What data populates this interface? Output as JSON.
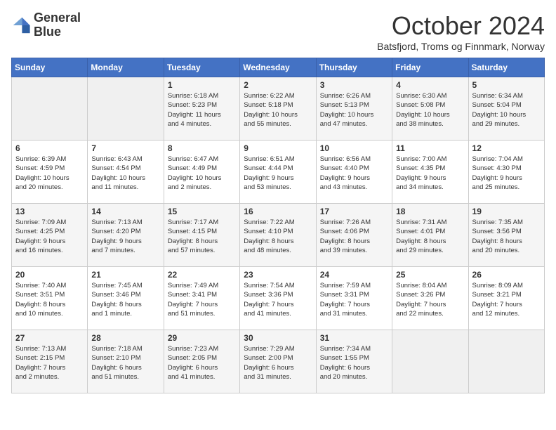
{
  "header": {
    "logo_line1": "General",
    "logo_line2": "Blue",
    "month": "October 2024",
    "location": "Batsfjord, Troms og Finnmark, Norway"
  },
  "weekdays": [
    "Sunday",
    "Monday",
    "Tuesday",
    "Wednesday",
    "Thursday",
    "Friday",
    "Saturday"
  ],
  "weeks": [
    [
      {
        "day": "",
        "info": ""
      },
      {
        "day": "",
        "info": ""
      },
      {
        "day": "1",
        "info": "Sunrise: 6:18 AM\nSunset: 5:23 PM\nDaylight: 11 hours\nand 4 minutes."
      },
      {
        "day": "2",
        "info": "Sunrise: 6:22 AM\nSunset: 5:18 PM\nDaylight: 10 hours\nand 55 minutes."
      },
      {
        "day": "3",
        "info": "Sunrise: 6:26 AM\nSunset: 5:13 PM\nDaylight: 10 hours\nand 47 minutes."
      },
      {
        "day": "4",
        "info": "Sunrise: 6:30 AM\nSunset: 5:08 PM\nDaylight: 10 hours\nand 38 minutes."
      },
      {
        "day": "5",
        "info": "Sunrise: 6:34 AM\nSunset: 5:04 PM\nDaylight: 10 hours\nand 29 minutes."
      }
    ],
    [
      {
        "day": "6",
        "info": "Sunrise: 6:39 AM\nSunset: 4:59 PM\nDaylight: 10 hours\nand 20 minutes."
      },
      {
        "day": "7",
        "info": "Sunrise: 6:43 AM\nSunset: 4:54 PM\nDaylight: 10 hours\nand 11 minutes."
      },
      {
        "day": "8",
        "info": "Sunrise: 6:47 AM\nSunset: 4:49 PM\nDaylight: 10 hours\nand 2 minutes."
      },
      {
        "day": "9",
        "info": "Sunrise: 6:51 AM\nSunset: 4:44 PM\nDaylight: 9 hours\nand 53 minutes."
      },
      {
        "day": "10",
        "info": "Sunrise: 6:56 AM\nSunset: 4:40 PM\nDaylight: 9 hours\nand 43 minutes."
      },
      {
        "day": "11",
        "info": "Sunrise: 7:00 AM\nSunset: 4:35 PM\nDaylight: 9 hours\nand 34 minutes."
      },
      {
        "day": "12",
        "info": "Sunrise: 7:04 AM\nSunset: 4:30 PM\nDaylight: 9 hours\nand 25 minutes."
      }
    ],
    [
      {
        "day": "13",
        "info": "Sunrise: 7:09 AM\nSunset: 4:25 PM\nDaylight: 9 hours\nand 16 minutes."
      },
      {
        "day": "14",
        "info": "Sunrise: 7:13 AM\nSunset: 4:20 PM\nDaylight: 9 hours\nand 7 minutes."
      },
      {
        "day": "15",
        "info": "Sunrise: 7:17 AM\nSunset: 4:15 PM\nDaylight: 8 hours\nand 57 minutes."
      },
      {
        "day": "16",
        "info": "Sunrise: 7:22 AM\nSunset: 4:10 PM\nDaylight: 8 hours\nand 48 minutes."
      },
      {
        "day": "17",
        "info": "Sunrise: 7:26 AM\nSunset: 4:06 PM\nDaylight: 8 hours\nand 39 minutes."
      },
      {
        "day": "18",
        "info": "Sunrise: 7:31 AM\nSunset: 4:01 PM\nDaylight: 8 hours\nand 29 minutes."
      },
      {
        "day": "19",
        "info": "Sunrise: 7:35 AM\nSunset: 3:56 PM\nDaylight: 8 hours\nand 20 minutes."
      }
    ],
    [
      {
        "day": "20",
        "info": "Sunrise: 7:40 AM\nSunset: 3:51 PM\nDaylight: 8 hours\nand 10 minutes."
      },
      {
        "day": "21",
        "info": "Sunrise: 7:45 AM\nSunset: 3:46 PM\nDaylight: 8 hours\nand 1 minute."
      },
      {
        "day": "22",
        "info": "Sunrise: 7:49 AM\nSunset: 3:41 PM\nDaylight: 7 hours\nand 51 minutes."
      },
      {
        "day": "23",
        "info": "Sunrise: 7:54 AM\nSunset: 3:36 PM\nDaylight: 7 hours\nand 41 minutes."
      },
      {
        "day": "24",
        "info": "Sunrise: 7:59 AM\nSunset: 3:31 PM\nDaylight: 7 hours\nand 31 minutes."
      },
      {
        "day": "25",
        "info": "Sunrise: 8:04 AM\nSunset: 3:26 PM\nDaylight: 7 hours\nand 22 minutes."
      },
      {
        "day": "26",
        "info": "Sunrise: 8:09 AM\nSunset: 3:21 PM\nDaylight: 7 hours\nand 12 minutes."
      }
    ],
    [
      {
        "day": "27",
        "info": "Sunrise: 7:13 AM\nSunset: 2:15 PM\nDaylight: 7 hours\nand 2 minutes."
      },
      {
        "day": "28",
        "info": "Sunrise: 7:18 AM\nSunset: 2:10 PM\nDaylight: 6 hours\nand 51 minutes."
      },
      {
        "day": "29",
        "info": "Sunrise: 7:23 AM\nSunset: 2:05 PM\nDaylight: 6 hours\nand 41 minutes."
      },
      {
        "day": "30",
        "info": "Sunrise: 7:29 AM\nSunset: 2:00 PM\nDaylight: 6 hours\nand 31 minutes."
      },
      {
        "day": "31",
        "info": "Sunrise: 7:34 AM\nSunset: 1:55 PM\nDaylight: 6 hours\nand 20 minutes."
      },
      {
        "day": "",
        "info": ""
      },
      {
        "day": "",
        "info": ""
      }
    ]
  ]
}
